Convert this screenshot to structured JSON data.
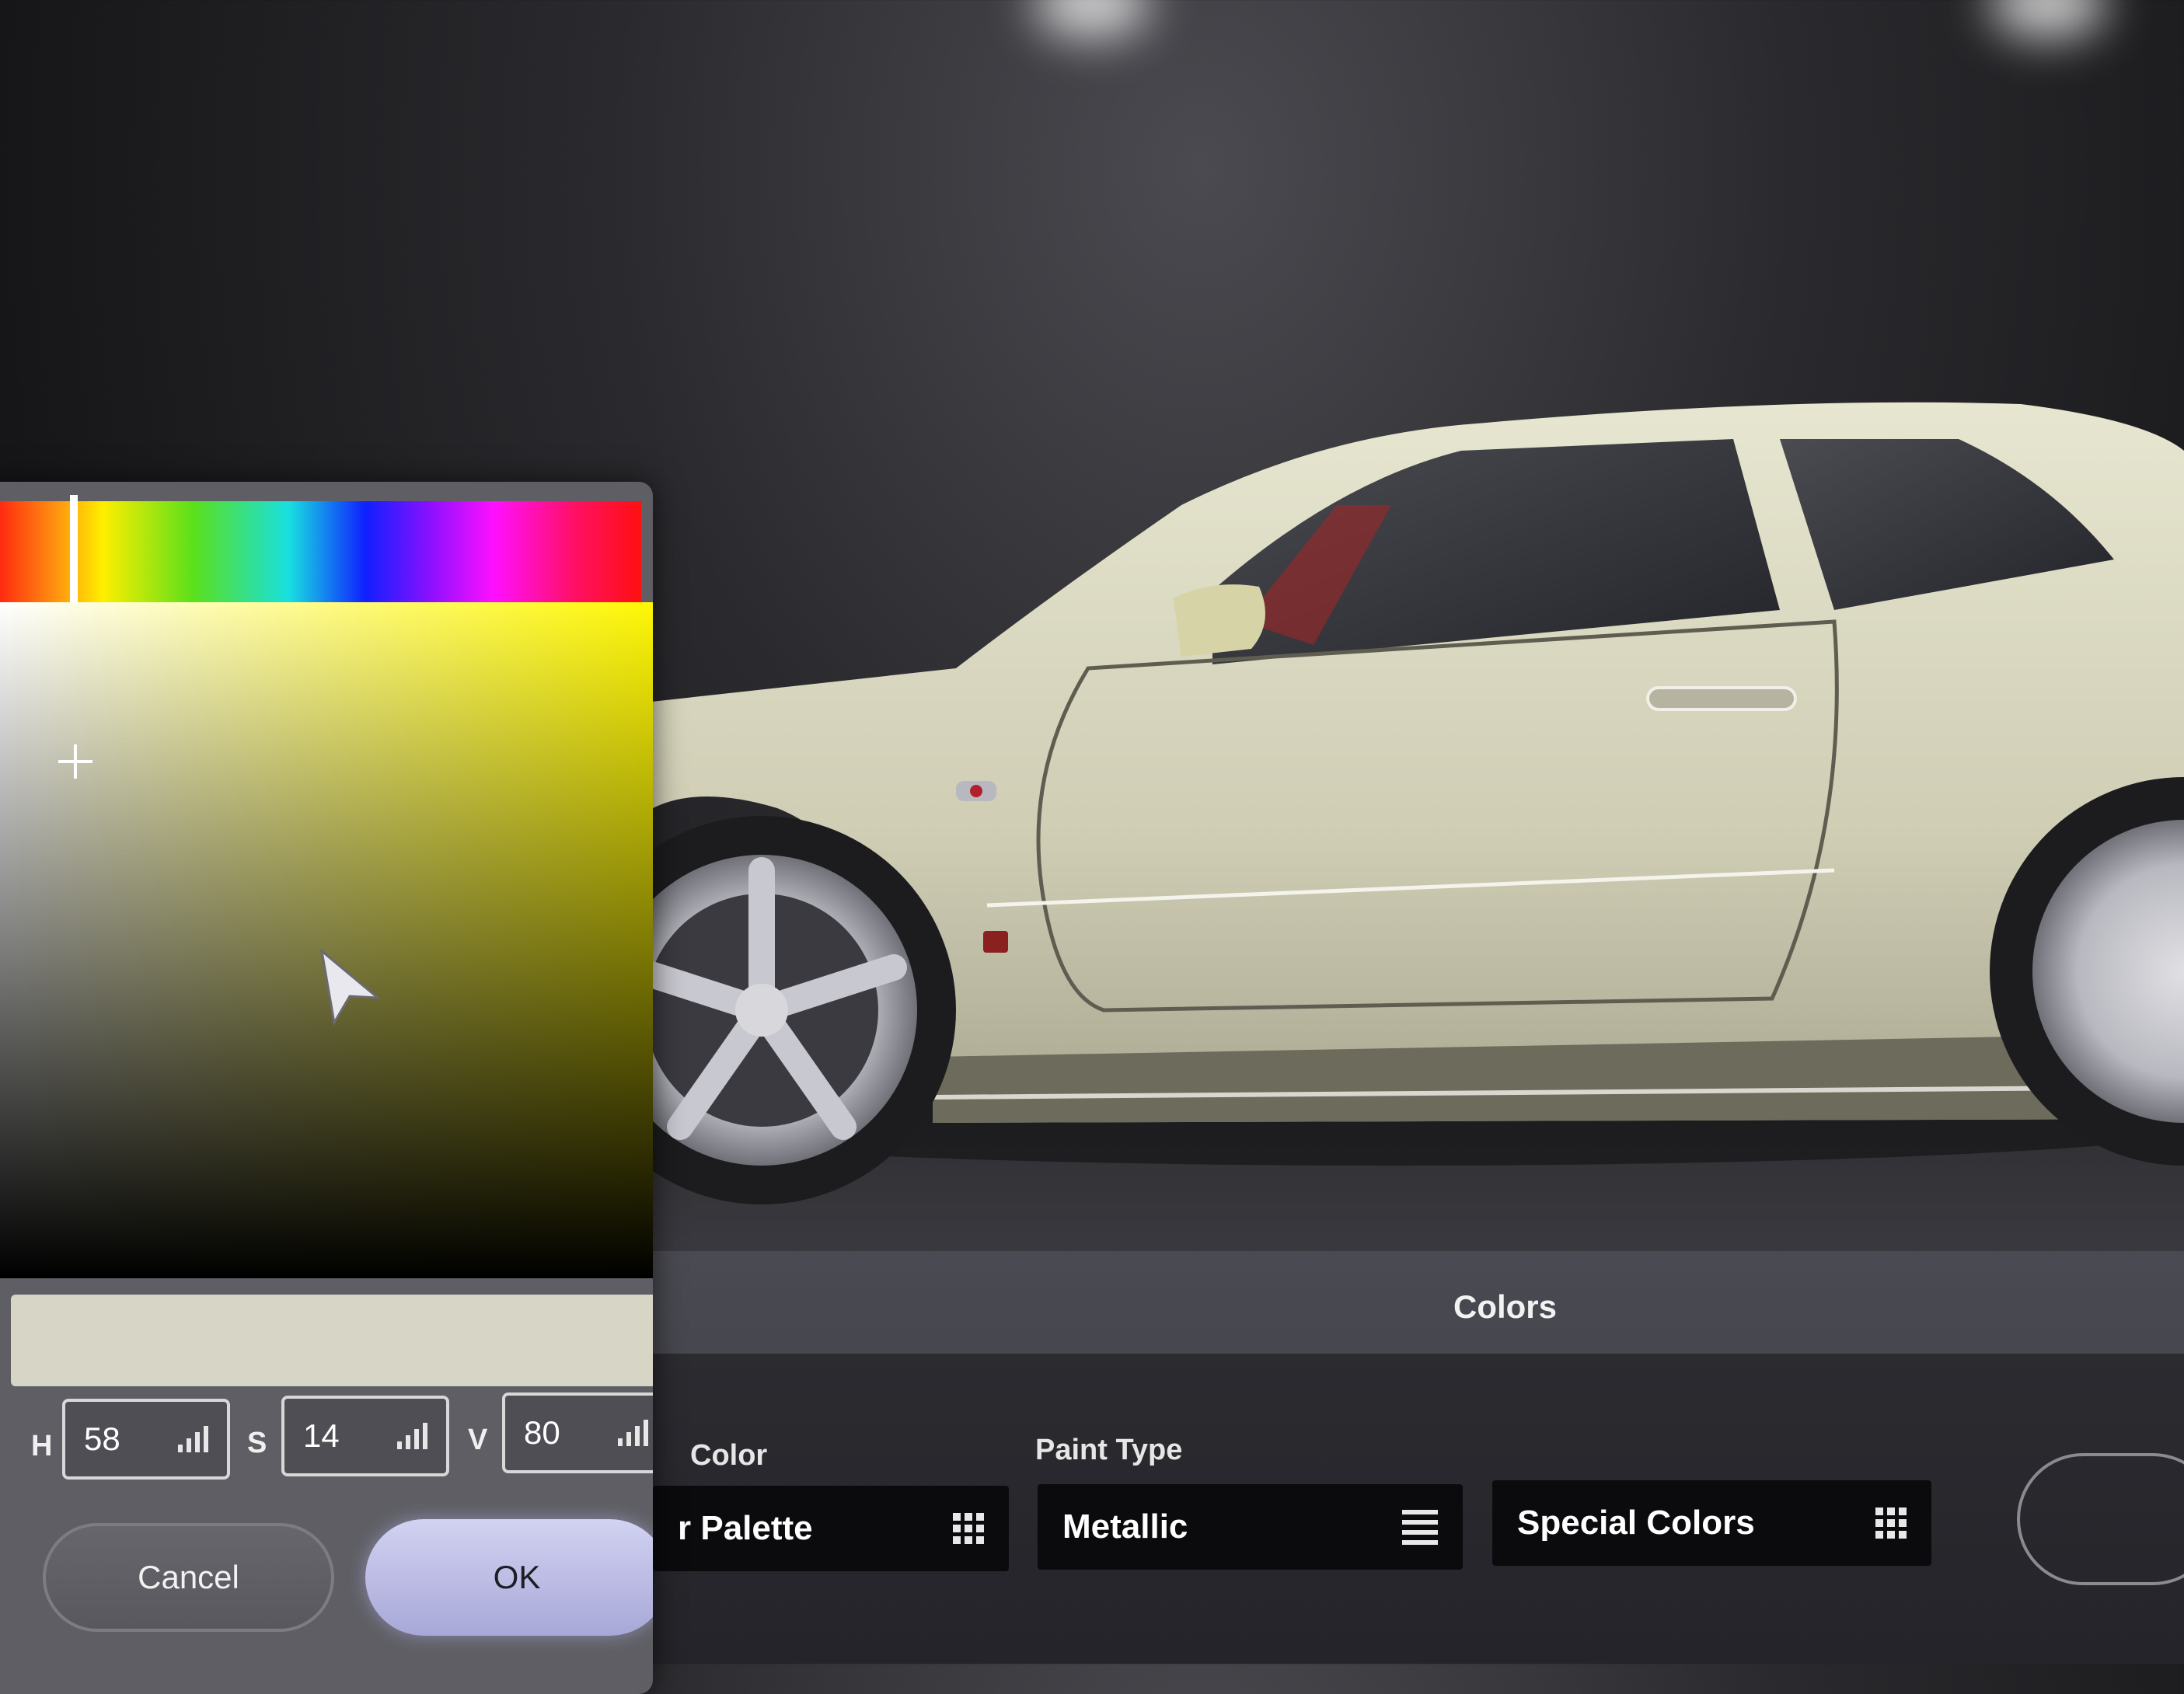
{
  "picker": {
    "h_label": "H",
    "h_value": "58",
    "s_label": "S",
    "s_value": "14",
    "v_label": "V",
    "v_value": "80",
    "cancel_label": "Cancel",
    "ok_label": "OK",
    "preview_color": "#d7d6c6"
  },
  "panel": {
    "title": "Colors",
    "color_label": "Color",
    "color_value": "r Palette",
    "paint_type_label": "Paint Type",
    "paint_type_value": "Metallic",
    "special_value": "Special Colors"
  },
  "icons": {
    "palette": "grid-icon",
    "paint_type": "list-icon",
    "special": "grid-icon",
    "hsv_adjust": "bars-icon"
  }
}
